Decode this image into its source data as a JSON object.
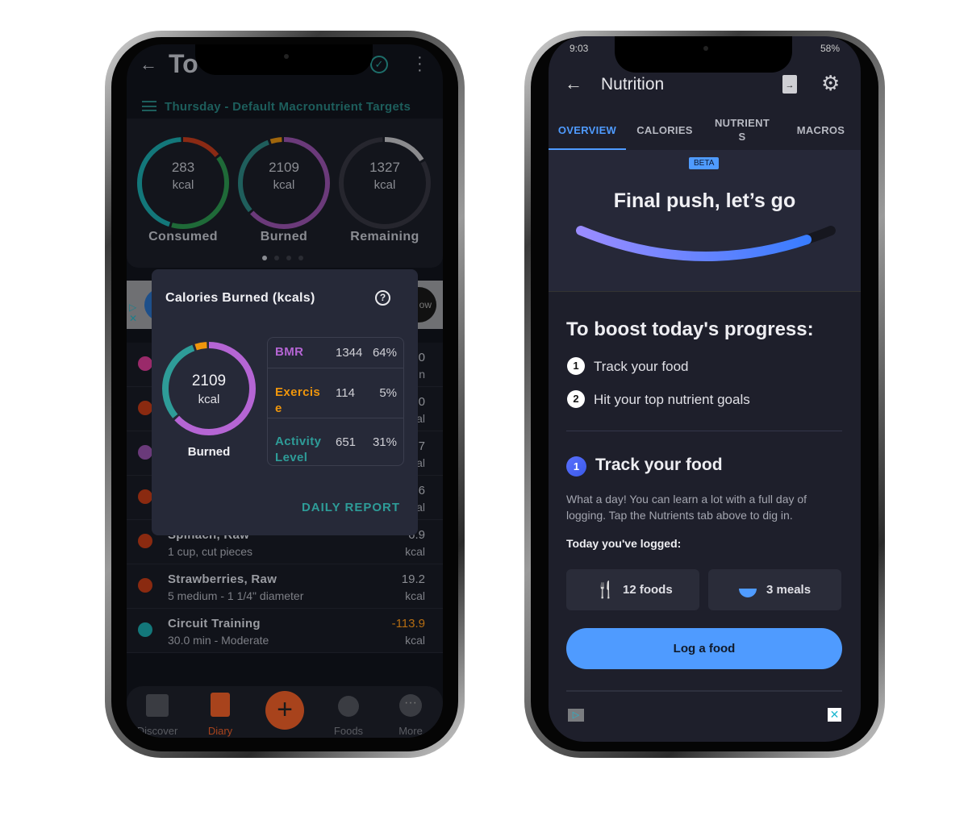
{
  "left_screen": {
    "header": {
      "title": "To",
      "title_partial_tail": "y",
      "back_icon": "arrow-left-icon",
      "check_icon": "check-circle-icon",
      "menu_icon": "more-vertical-icon"
    },
    "target_line": "Thursday - Default Macronutrient Targets",
    "rings": [
      {
        "value": "283",
        "unit": "kcal",
        "label": "Consumed",
        "segments": [
          {
            "color": "#8a2a14",
            "fraction": 0.15
          },
          {
            "color": "#1f6a38",
            "fraction": 0.4
          },
          {
            "color": "#13777a",
            "fraction": 0.45
          }
        ]
      },
      {
        "value": "2109",
        "unit": "kcal",
        "label": "Burned",
        "segments": [
          {
            "color": "#6b3a7a",
            "fraction": 0.64
          },
          {
            "color": "#1f5e5c",
            "fraction": 0.31
          },
          {
            "color": "#a0660c",
            "fraction": 0.05
          }
        ]
      },
      {
        "value": "1327",
        "unit": "kcal",
        "label": "Remaining",
        "segments": [
          {
            "color": "#8b8b8e",
            "fraction": 0.17
          },
          {
            "color": "#26262e",
            "fraction": 0.83
          }
        ]
      }
    ],
    "carousel_pages": 4,
    "carousel_active": 0,
    "ad": {
      "button_partial": "ow"
    },
    "popup": {
      "title": "Calories Burned (kcals)",
      "help_icon": "help-circle-icon",
      "ring": {
        "value": "2109",
        "unit": "kcal",
        "label": "Burned"
      },
      "rows": [
        {
          "name": "BMR",
          "kcal": "1344",
          "percent": "64%",
          "fraction": 0.64,
          "color": "#b565d4"
        },
        {
          "name": "Exercise",
          "kcal": "114",
          "percent": "5%",
          "fraction": 0.05,
          "color": "#f0960c"
        },
        {
          "name": "Activity Level",
          "kcal": "651",
          "percent": "31%",
          "fraction": 0.31,
          "color": "#2e9c98"
        }
      ],
      "action": "DAILY REPORT"
    },
    "diary": [
      {
        "icon": "heart-icon",
        "color": "#9a2a6a",
        "v1": "0",
        "v2": "n"
      },
      {
        "icon": "apple-icon",
        "color": "#8a2a10",
        "v1": "0",
        "v2": "al"
      },
      {
        "icon": "pill-icon",
        "color": "#6a3a7a",
        "v1": "7",
        "v2": "al"
      },
      {
        "icon": "apple-icon",
        "color": "#8a2a10",
        "v1": "6",
        "v2": "al"
      },
      {
        "icon": "apple-icon",
        "color": "#8a2a10",
        "name": "Spinach, Raw",
        "detail": "1 cup, cut pieces",
        "v1": "6.9",
        "v2": "kcal"
      },
      {
        "icon": "apple-icon",
        "color": "#8a2a10",
        "name": "Strawberries, Raw",
        "detail": "5 medium - 1 1/4\" diameter",
        "v1": "19.2",
        "v2": "kcal"
      },
      {
        "icon": "running-icon",
        "color": "#13777a",
        "name": "Circuit Training",
        "detail": "30.0 min - Moderate",
        "v1": "-113.9",
        "v2": "kcal",
        "v1_color": "#b56d12"
      }
    ],
    "nav": [
      {
        "label": "Discover",
        "icon": "bar-chart-icon"
      },
      {
        "label": "Diary",
        "icon": "notebook-icon",
        "active": true
      },
      {
        "label": "Foods",
        "icon": "apple-icon"
      },
      {
        "label": "More",
        "icon": "more-horizontal-icon"
      }
    ],
    "accent": "#a8431c"
  },
  "right_screen": {
    "status": {
      "time": "9:03",
      "battery": "58%"
    },
    "header": {
      "title": "Nutrition",
      "back_icon": "arrow-left-icon",
      "export_icon": "file-export-icon",
      "settings_icon": "gear-icon"
    },
    "tabs": [
      {
        "label": "OVERVIEW",
        "active": true
      },
      {
        "label": "CALORIES"
      },
      {
        "label": "NUTRIENTS"
      },
      {
        "label": "MACROS"
      }
    ],
    "badge": "BETA",
    "headline": "Final push, let’s go",
    "progress": 0.9,
    "boost_title": "To boost today's progress:",
    "steps": [
      {
        "n": "1",
        "text": "Track your food"
      },
      {
        "n": "2",
        "text": "Hit your top nutrient goals"
      }
    ],
    "section": {
      "n": "1",
      "title": "Track your food",
      "body": "What a day! You can learn a lot with a full day of logging. Tap the Nutrients tab above to dig in.",
      "logged_label": "Today you've logged:"
    },
    "stats": [
      {
        "icon": "fork-spoon-icon",
        "text": "12 foods"
      },
      {
        "icon": "bowl-icon",
        "text": "3 meals"
      }
    ],
    "cta": "Log a food",
    "accent": "#4f9bff"
  }
}
